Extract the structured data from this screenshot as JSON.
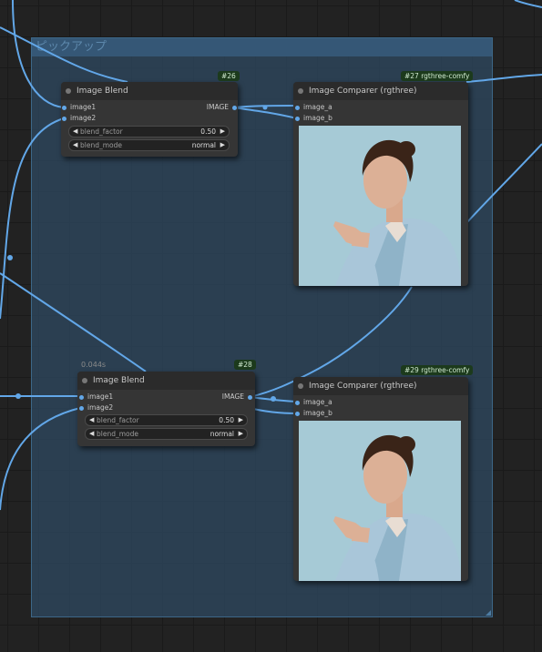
{
  "canvas": {
    "background": "#222222",
    "wire_color": "#62a7e8"
  },
  "group": {
    "title": "ピックアップ",
    "color": "#3d6788"
  },
  "nodes": [
    {
      "id": "#26",
      "title": "Image Blend",
      "inputs": [
        "image1",
        "image2"
      ],
      "outputs": [
        "IMAGE"
      ],
      "widgets": [
        {
          "name": "blend_factor",
          "value": "0.50"
        },
        {
          "name": "blend_mode",
          "value": "normal"
        }
      ]
    },
    {
      "id": "#27 rgthree-comfy",
      "title": "Image Comparer (rgthree)",
      "inputs": [
        "image_a",
        "image_b"
      ],
      "image": "portrait-woman-light-blue-suit-pointing"
    },
    {
      "id": "#28",
      "timing": "0.044s",
      "title": "Image Blend",
      "inputs": [
        "image1",
        "image2"
      ],
      "outputs": [
        "IMAGE"
      ],
      "widgets": [
        {
          "name": "blend_factor",
          "value": "0.50"
        },
        {
          "name": "blend_mode",
          "value": "normal"
        }
      ]
    },
    {
      "id": "#29 rgthree-comfy",
      "title": "Image Comparer (rgthree)",
      "inputs": [
        "image_a",
        "image_b"
      ],
      "image": "portrait-woman-light-blue-suit-pointing"
    }
  ],
  "icons": {
    "left_arrow": "◀",
    "right_arrow": "▶"
  }
}
